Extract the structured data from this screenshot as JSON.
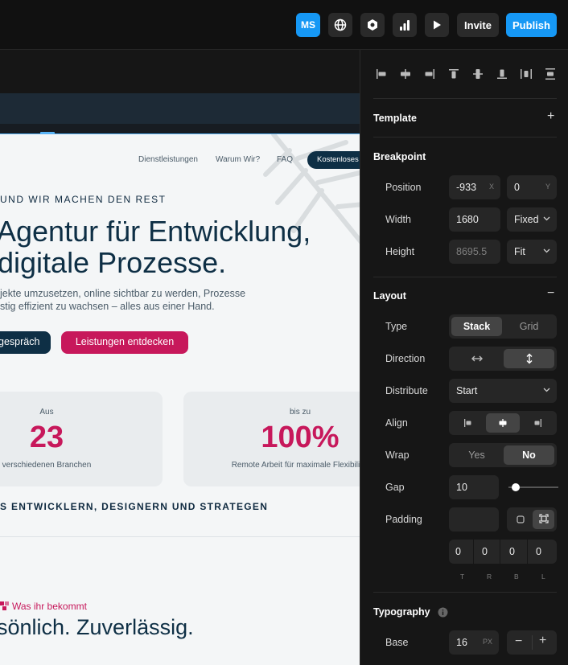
{
  "topbar": {
    "avatar_initials": "MS",
    "invite_label": "Invite",
    "publish_label": "Publish",
    "icons": [
      "globe-icon",
      "hexagon-icon",
      "analytics-icon",
      "play-icon"
    ],
    "accent_color": "#1698f5"
  },
  "site": {
    "nav": [
      "Dienstleistungen",
      "Warum Wir?",
      "FAQ"
    ],
    "nav_cta": "Kostenloses",
    "eyebrow": "UND WIR MACHEN DEN REST",
    "hero_line1": "Agentur für Entwicklung,",
    "hero_line2": "digitale Prozesse.",
    "lead_line1": "jekte umzusetzen, online sichtbar zu werden, Prozesse",
    "lead_line2": "stig effizient zu wachsen – alles aus einer Hand.",
    "btn_primary": "gespräch",
    "btn_secondary": "Leistungen entdecken",
    "stats": [
      {
        "prefix": "Aus",
        "value": "23",
        "desc": "verschiedenen Branchen"
      },
      {
        "prefix": "bis zu",
        "value": "100%",
        "desc": "Remote Arbeit für maximale Flexibilität"
      }
    ],
    "team_line": "S ENTWICKLERN, DESIGNERN UND STRATEGEN",
    "kicker": "Was ihr bekommt",
    "section_title": "sönlich. Zuverlässig.",
    "brand_color": "#c7185b",
    "navy_color": "#0e2f45"
  },
  "panel": {
    "template": {
      "title": "Template",
      "action": "+"
    },
    "breakpoint": {
      "title": "Breakpoint",
      "position_label": "Position",
      "position_x": "-933",
      "position_x_unit": "X",
      "position_y": "0",
      "position_y_unit": "Y",
      "width_label": "Width",
      "width_value": "1680",
      "width_mode": "Fixed",
      "height_label": "Height",
      "height_value": "8695.5",
      "height_mode": "Fit"
    },
    "layout": {
      "title": "Layout",
      "action": "−",
      "type_label": "Type",
      "type_options": [
        "Stack",
        "Grid"
      ],
      "type_selected": "Stack",
      "direction_label": "Direction",
      "distribute_label": "Distribute",
      "distribute_value": "Start",
      "align_label": "Align",
      "wrap_label": "Wrap",
      "wrap_options": [
        "Yes",
        "No"
      ],
      "wrap_selected": "No",
      "gap_label": "Gap",
      "gap_value": "10",
      "padding_label": "Padding",
      "padding_values": [
        "0",
        "0",
        "0",
        "0"
      ],
      "padding_sides": [
        "T",
        "R",
        "B",
        "L"
      ]
    },
    "typography": {
      "title": "Typography",
      "base_label": "Base",
      "base_value": "16",
      "base_unit": "PX",
      "minus": "−",
      "plus": "+"
    }
  }
}
